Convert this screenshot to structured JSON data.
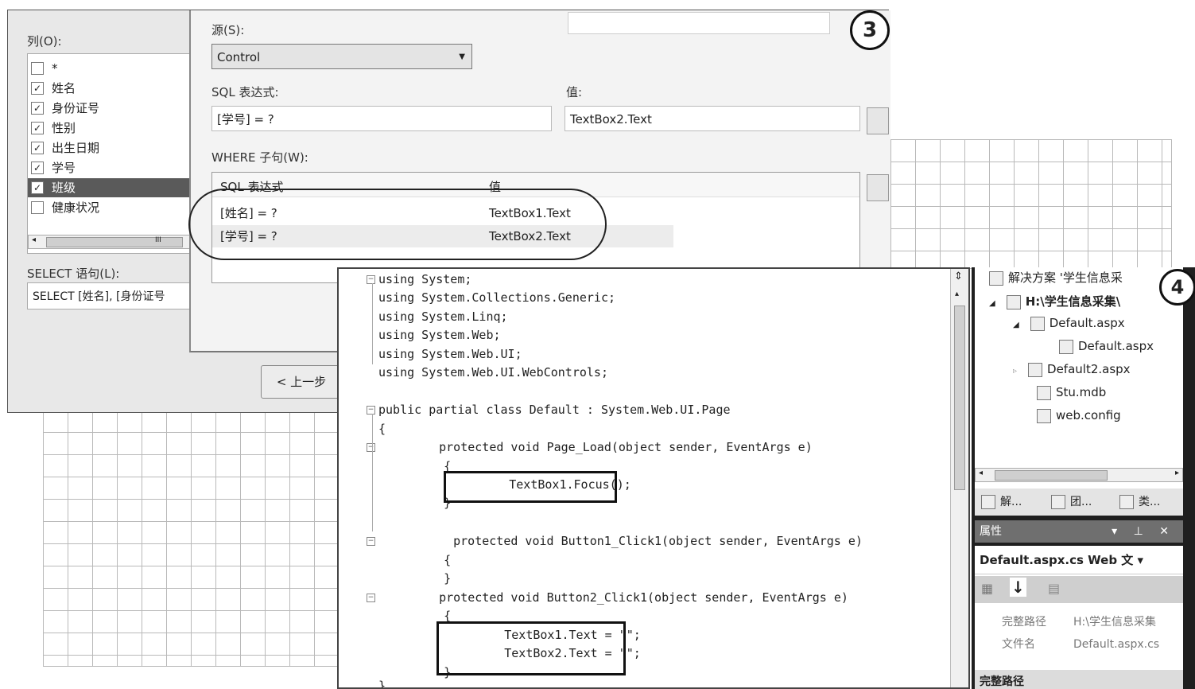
{
  "dialog": {
    "columns_label": "列(O):",
    "columns": [
      {
        "name": "*",
        "checked": false,
        "selected": false
      },
      {
        "name": "姓名",
        "checked": true,
        "selected": false
      },
      {
        "name": "身份证号",
        "checked": true,
        "selected": false
      },
      {
        "name": "性别",
        "checked": true,
        "selected": false
      },
      {
        "name": "出生日期",
        "checked": true,
        "selected": false
      },
      {
        "name": "学号",
        "checked": true,
        "selected": false
      },
      {
        "name": "班级",
        "checked": true,
        "selected": true
      },
      {
        "name": "健康状况",
        "checked": false,
        "selected": false
      }
    ],
    "check_mark": "✓",
    "select_label": "SELECT 语句(L):",
    "select_value": "SELECT [姓名], [身份证号",
    "source_label": "源(S):",
    "source_value": "Control",
    "sql_expr_label": "SQL 表达式:",
    "sql_expr_value": "[学号] = ?",
    "value_label": "值:",
    "value_value": "TextBox2.Text",
    "where_label": "WHERE 子句(W):",
    "where_headers": [
      "SQL 表达式",
      "值"
    ],
    "where_rows": [
      {
        "expr": "[姓名] = ?",
        "value": "TextBox1.Text"
      },
      {
        "expr": "[学号] = ?",
        "value": "TextBox2.Text"
      }
    ],
    "prev_button": "< 上一步",
    "scroll_mark": "III",
    "step_badge": "3"
  },
  "editor": {
    "lines": [
      "using System;",
      "using System.Collections.Generic;",
      "using System.Linq;",
      "using System.Web;",
      "using System.Web.UI;",
      "using System.Web.UI.WebControls;",
      "public partial class Default : System.Web.UI.Page",
      "{",
      "    protected void Page_Load(object sender, EventArgs e)",
      "    {",
      "        TextBox1.Focus();",
      "    }",
      "    protected void Button1_Click1(object sender, EventArgs e)",
      "    {",
      "    }",
      "    protected void Button2_Click1(object sender, EventArgs e)",
      "    {",
      "        TextBox1.Text = \"\";",
      "        TextBox2.Text = \"\";",
      "    }",
      "}"
    ]
  },
  "solution": {
    "header": "解决方案 '学生信息采",
    "root": "H:\\学生信息采集\\",
    "items": [
      "Default.aspx",
      "Default.aspx",
      "Default2.aspx",
      "Stu.mdb",
      "web.config"
    ],
    "tabs": [
      "解...",
      "团...",
      "类..."
    ],
    "step_badge": "4"
  },
  "properties": {
    "title": "属性",
    "title_controls": "▾ ⊥ ✕",
    "selected": "Default.aspx.cs Web 文 ▾",
    "rows": [
      {
        "key": "完整路径",
        "value": "H:\\学生信息采集"
      },
      {
        "key": "文件名",
        "value": "Default.aspx.cs"
      }
    ],
    "bottom": "完整路径"
  }
}
